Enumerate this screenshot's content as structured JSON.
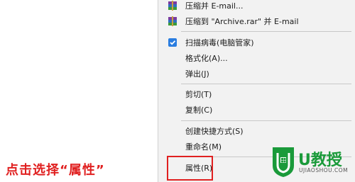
{
  "context_menu": {
    "items": [
      {
        "label": "压缩并 E-mail...",
        "icon": "winrar-icon"
      },
      {
        "label": "压缩到 \"Archive.rar\" 并 E-mail",
        "icon": "winrar-icon"
      },
      {
        "label": "扫描病毒(电脑管家)",
        "icon": "shield-icon"
      },
      {
        "label": "格式化(A)..."
      },
      {
        "label": "弹出(J)"
      },
      {
        "label": "剪切(T)"
      },
      {
        "label": "复制(C)"
      },
      {
        "label": "创建快捷方式(S)"
      },
      {
        "label": "重命名(M)"
      },
      {
        "label": "属性(R)"
      }
    ]
  },
  "instruction": "点击选择“属性”",
  "watermark": {
    "brand": "U教授",
    "url": "UJIAOSHOU.COM"
  },
  "colors": {
    "highlight": "#e02020",
    "logo_green": "#1a9a3a",
    "menu_bg": "#f2f2f2"
  }
}
